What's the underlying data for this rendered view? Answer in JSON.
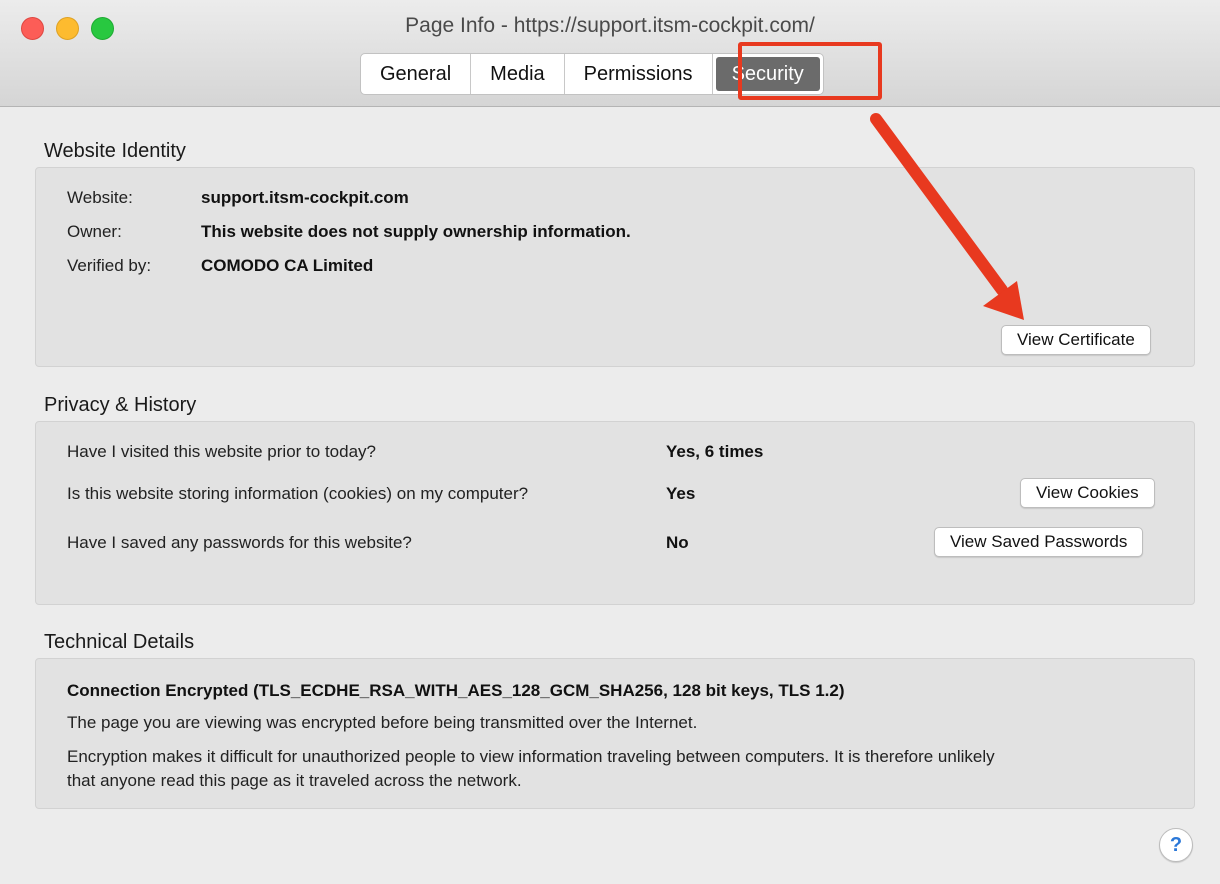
{
  "window": {
    "title": "Page Info - https://support.itsm-cockpit.com/"
  },
  "tabs": [
    {
      "label": "General",
      "active": false
    },
    {
      "label": "Media",
      "active": false
    },
    {
      "label": "Permissions",
      "active": false
    },
    {
      "label": "Security",
      "active": true
    }
  ],
  "colors": {
    "highlight": "#e8391f",
    "arrow": "#e8391f",
    "active_tab": "#6b6b6b"
  },
  "identity": {
    "heading": "Website Identity",
    "website_label": "Website:",
    "website_value": "support.itsm-cockpit.com",
    "owner_label": "Owner:",
    "owner_value": "This website does not supply ownership information.",
    "verified_label": "Verified by:",
    "verified_value": "COMODO CA Limited",
    "view_certificate": "View Certificate"
  },
  "privacy": {
    "heading": "Privacy & History",
    "q1": "Have I visited this website prior to today?",
    "a1": "Yes, 6 times",
    "q2": "Is this website storing information (cookies) on my computer?",
    "a2": "Yes",
    "view_cookies": "View Cookies",
    "q3": "Have I saved any passwords for this website?",
    "a3": "No",
    "view_passwords": "View Saved Passwords"
  },
  "technical": {
    "heading": "Technical Details",
    "connection": "Connection Encrypted (TLS_ECDHE_RSA_WITH_AES_128_GCM_SHA256, 128 bit keys, TLS 1.2)",
    "line1": "The page you are viewing was encrypted before being transmitted over the Internet.",
    "line2a": "Encryption makes it difficult for unauthorized people to view information traveling between computers. It is therefore unlikely",
    "line2b": "that anyone read this page as it traveled across the network."
  },
  "help": {
    "glyph": "?"
  }
}
